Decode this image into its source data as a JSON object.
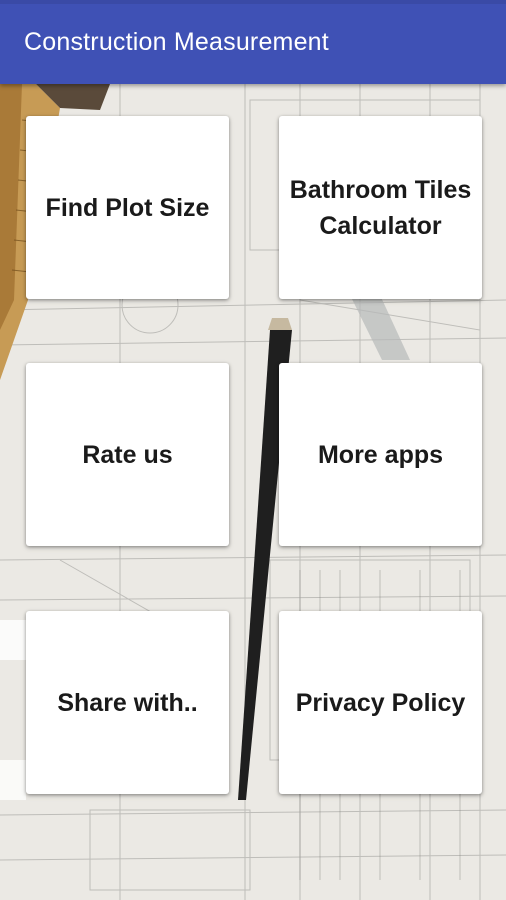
{
  "app_bar": {
    "title": "Construction Measurement",
    "color": "#3f51b5"
  },
  "menu": {
    "items": [
      {
        "label": "Find Plot Size"
      },
      {
        "label": "Bathroom Tiles Calculator"
      },
      {
        "label": "Rate us"
      },
      {
        "label": "More apps"
      },
      {
        "label": "Share with.."
      },
      {
        "label": "Privacy Policy"
      }
    ]
  },
  "background": {
    "description_icon": "blueprint-background-image"
  }
}
